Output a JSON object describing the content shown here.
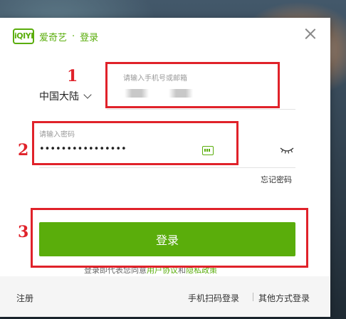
{
  "header": {
    "logo_text": "iQIYI",
    "brand": "爱奇艺",
    "separator": "·",
    "title": "登录"
  },
  "form": {
    "region": "中国大陆",
    "phone_placeholder": "请输入手机号或邮箱",
    "password_label": "请输入密码",
    "password_value": "••••••••••••••••",
    "forgot": "忘记密码",
    "login_button": "登录",
    "agreement_prefix": "登录即代表您同意",
    "agreement_link1": "用户协议",
    "agreement_and": "和",
    "agreement_link2": "隐私政策"
  },
  "footer": {
    "register": "注册",
    "scan_login": "手机扫码登录",
    "other_login": "其他方式登录"
  },
  "annotations": {
    "n1": "1",
    "n2": "2",
    "n3": "3"
  },
  "colors": {
    "accent": "#5aad0b",
    "annotation": "#e0222a"
  }
}
